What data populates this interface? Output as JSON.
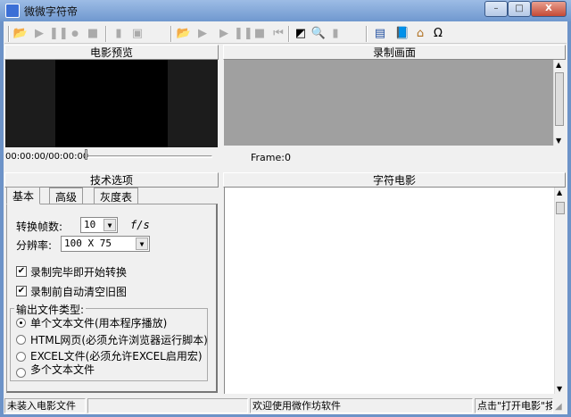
{
  "window": {
    "title": "微微字符帝",
    "min": "–",
    "max": "□",
    "close": "X"
  },
  "toolbar": {
    "left": [
      "open-movie",
      "play",
      "pause",
      "record",
      "stop",
      "frame",
      "save"
    ],
    "right": [
      "open",
      "play",
      "play-next",
      "pause",
      "stop",
      "first",
      "contrast",
      "zoom",
      "page",
      "list",
      "help-book",
      "home",
      "about"
    ]
  },
  "preview": {
    "header": "电影预览",
    "time": "00:00:00/00:00:00"
  },
  "record": {
    "header": "录制画面",
    "frame": "Frame:0"
  },
  "options": {
    "header": "技术选项",
    "tabs": [
      "基本",
      "高级",
      "灰度表"
    ],
    "fps_label": "转换帧数:",
    "fps_value": "10",
    "fps_unit": "f/s",
    "res_label": "分辨率:",
    "res_value": "100 X 75",
    "check1": "录制完毕即开始转换",
    "check2": "录制前自动清空旧图",
    "group_label": "输出文件类型:",
    "radios": [
      "单个文本文件(用本程序播放)",
      "HTML网页(必须允许浏览器运行脚本)",
      "EXCEL文件(必须允许EXCEL启用宏)",
      "多个文本文件"
    ]
  },
  "ascii": {
    "header": "字符电影"
  },
  "statusbar": {
    "s1": "未装入电影文件",
    "s2": "",
    "s3": "欢迎使用微作坊软件",
    "s4": "点击\"打开电影\"按"
  }
}
